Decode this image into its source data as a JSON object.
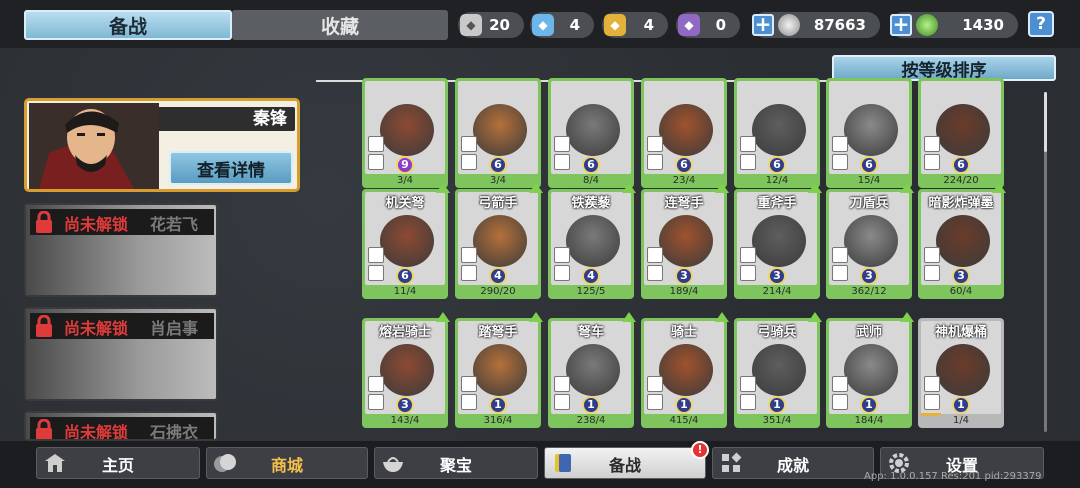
{
  "tabs": {
    "active": "备战",
    "inactive": "收藏"
  },
  "resources": [
    {
      "icon": "silver-shield-icon",
      "value": "20",
      "color": "#c9c9c9"
    },
    {
      "icon": "blue-shield-icon",
      "value": "4",
      "color": "#6cb6e9"
    },
    {
      "icon": "gold-shield-icon",
      "value": "4",
      "color": "#e4b13b"
    },
    {
      "icon": "purple-shield-icon",
      "value": "0",
      "color": "#8f69c4"
    }
  ],
  "currency": {
    "silver": "87663",
    "gem": "1430"
  },
  "help_label": "?",
  "sort_label": "按等级排序",
  "hero_selected": {
    "name": "秦锋",
    "detail_label": "查看详情"
  },
  "heroes_locked": [
    {
      "lock_text": "尚未解锁",
      "name": "花若飞"
    },
    {
      "lock_text": "尚未解锁",
      "name": "肖启事"
    },
    {
      "lock_text": "尚未解锁",
      "name": "石拂衣"
    }
  ],
  "units_row1": [
    {
      "name": "",
      "level": "9",
      "count": "3/4",
      "purple": true
    },
    {
      "name": "",
      "level": "6",
      "count": "3/4"
    },
    {
      "name": "",
      "level": "6",
      "count": "8/4"
    },
    {
      "name": "",
      "level": "6",
      "count": "23/4"
    },
    {
      "name": "",
      "level": "6",
      "count": "12/4"
    },
    {
      "name": "",
      "level": "6",
      "count": "15/4"
    },
    {
      "name": "",
      "level": "6",
      "count": "224/20"
    }
  ],
  "units_row2": [
    {
      "name": "机关弩",
      "level": "6",
      "count": "11/4"
    },
    {
      "name": "弓箭手",
      "level": "4",
      "count": "290/20"
    },
    {
      "name": "铁蒺藜",
      "level": "4",
      "count": "125/5"
    },
    {
      "name": "连弩手",
      "level": "3",
      "count": "189/4"
    },
    {
      "name": "重斧手",
      "level": "3",
      "count": "214/4"
    },
    {
      "name": "刀盾兵",
      "level": "3",
      "count": "362/12"
    },
    {
      "name": "暗影炸弹墨",
      "level": "3",
      "count": "60/4"
    }
  ],
  "units_row3": [
    {
      "name": "熔岩骑士",
      "level": "3",
      "count": "143/4"
    },
    {
      "name": "踏弩手",
      "level": "1",
      "count": "316/4"
    },
    {
      "name": "弩车",
      "level": "1",
      "count": "238/4"
    },
    {
      "name": "骑士",
      "level": "1",
      "count": "415/4"
    },
    {
      "name": "弓骑兵",
      "level": "1",
      "count": "351/4"
    },
    {
      "name": "武师",
      "level": "1",
      "count": "184/4"
    },
    {
      "name": "神机爆桶",
      "level": "1",
      "count": "1/4"
    }
  ],
  "nav": [
    {
      "label": "主页",
      "icon": "home-icon"
    },
    {
      "label": "商城",
      "icon": "coins-icon"
    },
    {
      "label": "聚宝",
      "icon": "treasure-bowl-icon"
    },
    {
      "label": "备战",
      "icon": "flag-icon"
    },
    {
      "label": "成就",
      "icon": "achievement-icon"
    },
    {
      "label": "设置",
      "icon": "gear-icon"
    }
  ],
  "nav_badge": "!",
  "version": "App: 1.0.0.157 Res:201 pid:293379"
}
